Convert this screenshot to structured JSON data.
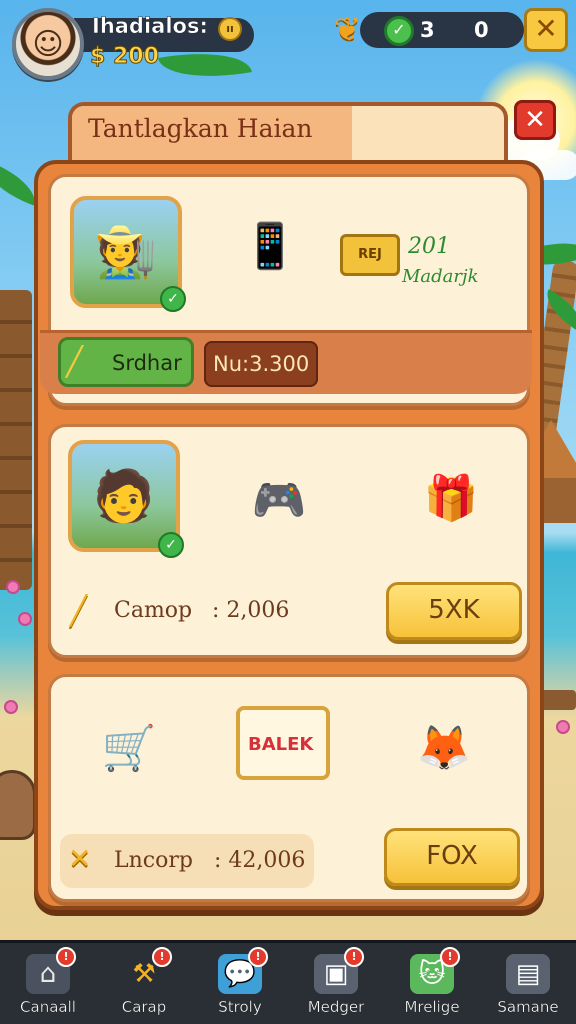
{
  "player": {
    "name": "Ihadialos:",
    "coins": "$ 200",
    "badge": "ıı"
  },
  "resources": {
    "value_1": "3",
    "value_2": "0"
  },
  "panel": {
    "title": "Tantlagkan Haian"
  },
  "card_1": {
    "tag_label": "REJ",
    "level_number": "201",
    "level_name": "Madarjk",
    "action_label": "Srdhar",
    "price": "Nu:3.300"
  },
  "card_2": {
    "stat_label": "Camop",
    "stat_value": ": 2,006",
    "button_label": "5XK"
  },
  "card_3": {
    "sign_text": "BALEK",
    "stat_label": "Lncorp",
    "stat_value": ": 42,006",
    "button_label": "FOX"
  },
  "nav": [
    {
      "label": "Canaall",
      "icon": "house-icon",
      "badge": "!"
    },
    {
      "label": "Carap",
      "icon": "hammer-icon",
      "badge": "!"
    },
    {
      "label": "Stroly",
      "icon": "chat-icon",
      "badge": "!"
    },
    {
      "label": "Medger",
      "icon": "tv-icon",
      "badge": "!"
    },
    {
      "label": "Mrelige",
      "icon": "cat-icon",
      "badge": "!"
    },
    {
      "label": "Samane",
      "icon": "chest-icon",
      "badge": ""
    }
  ],
  "colors": {
    "panel": "#e9843d",
    "card": "#fdf1d8",
    "button": "#f7c23a",
    "close": "#e23a2c",
    "nav": "#2a2f36"
  }
}
